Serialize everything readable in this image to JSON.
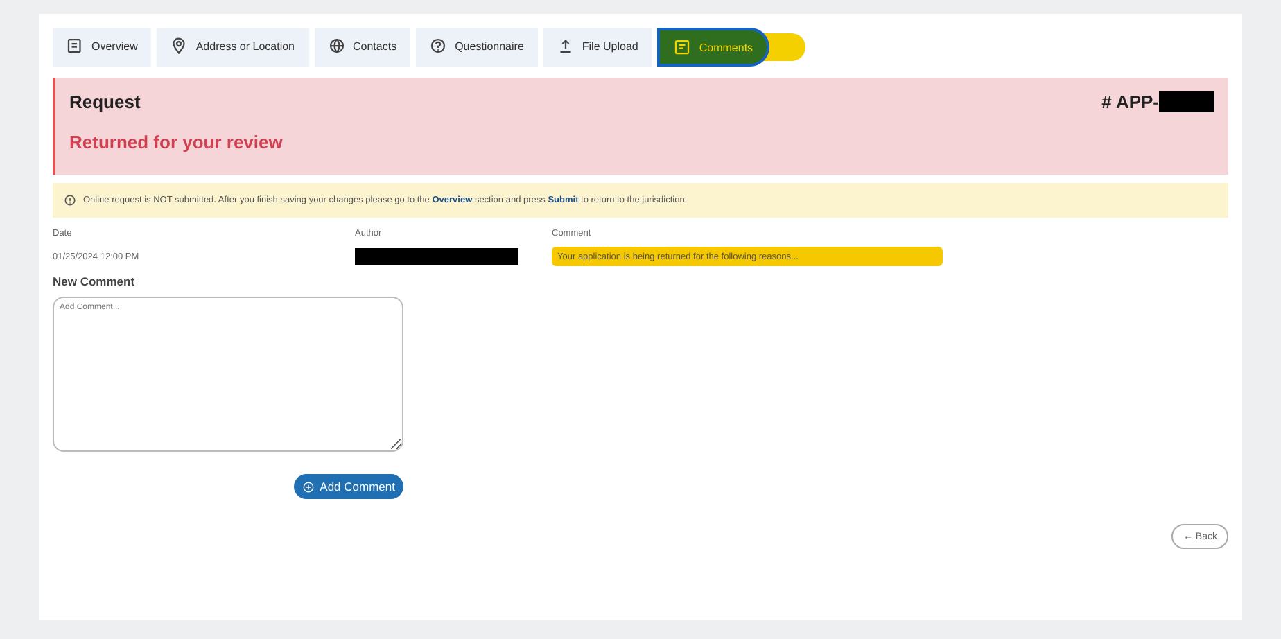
{
  "tabs": [
    {
      "label": "Overview",
      "kind": "document",
      "selected": false,
      "highlighted": false
    },
    {
      "label": "Address or Location",
      "kind": "pin",
      "selected": false,
      "highlighted": false
    },
    {
      "label": "Contacts",
      "kind": "globe",
      "selected": false,
      "highlighted": false
    },
    {
      "label": "Questionnaire",
      "kind": "question",
      "selected": false,
      "highlighted": false
    },
    {
      "label": "File Upload",
      "kind": "upload",
      "selected": false,
      "highlighted": false
    },
    {
      "label": "Comments",
      "kind": "comment",
      "selected": true,
      "highlighted": true
    }
  ],
  "request": {
    "title": "Request",
    "number": "# APP-",
    "number_redacted": true,
    "status": "Returned for your review"
  },
  "notice": {
    "text": "Online request is NOT submitted. After you finish saving your changes please go to the **Overview** section and press **Submit** to return to the jurisdiction."
  },
  "comments_table": {
    "columns": [
      "Date",
      "Author",
      "Comment"
    ],
    "rows": [
      {
        "date": "01/25/2024 12:00 PM",
        "author_redacted": true,
        "comment": "Your application is being returned for the following reasons...",
        "highlighted": true
      }
    ]
  },
  "new_comment": {
    "label": "New Comment",
    "placeholder": "Add Comment..."
  },
  "add_button": "Add Comment",
  "back_button": "← Back"
}
